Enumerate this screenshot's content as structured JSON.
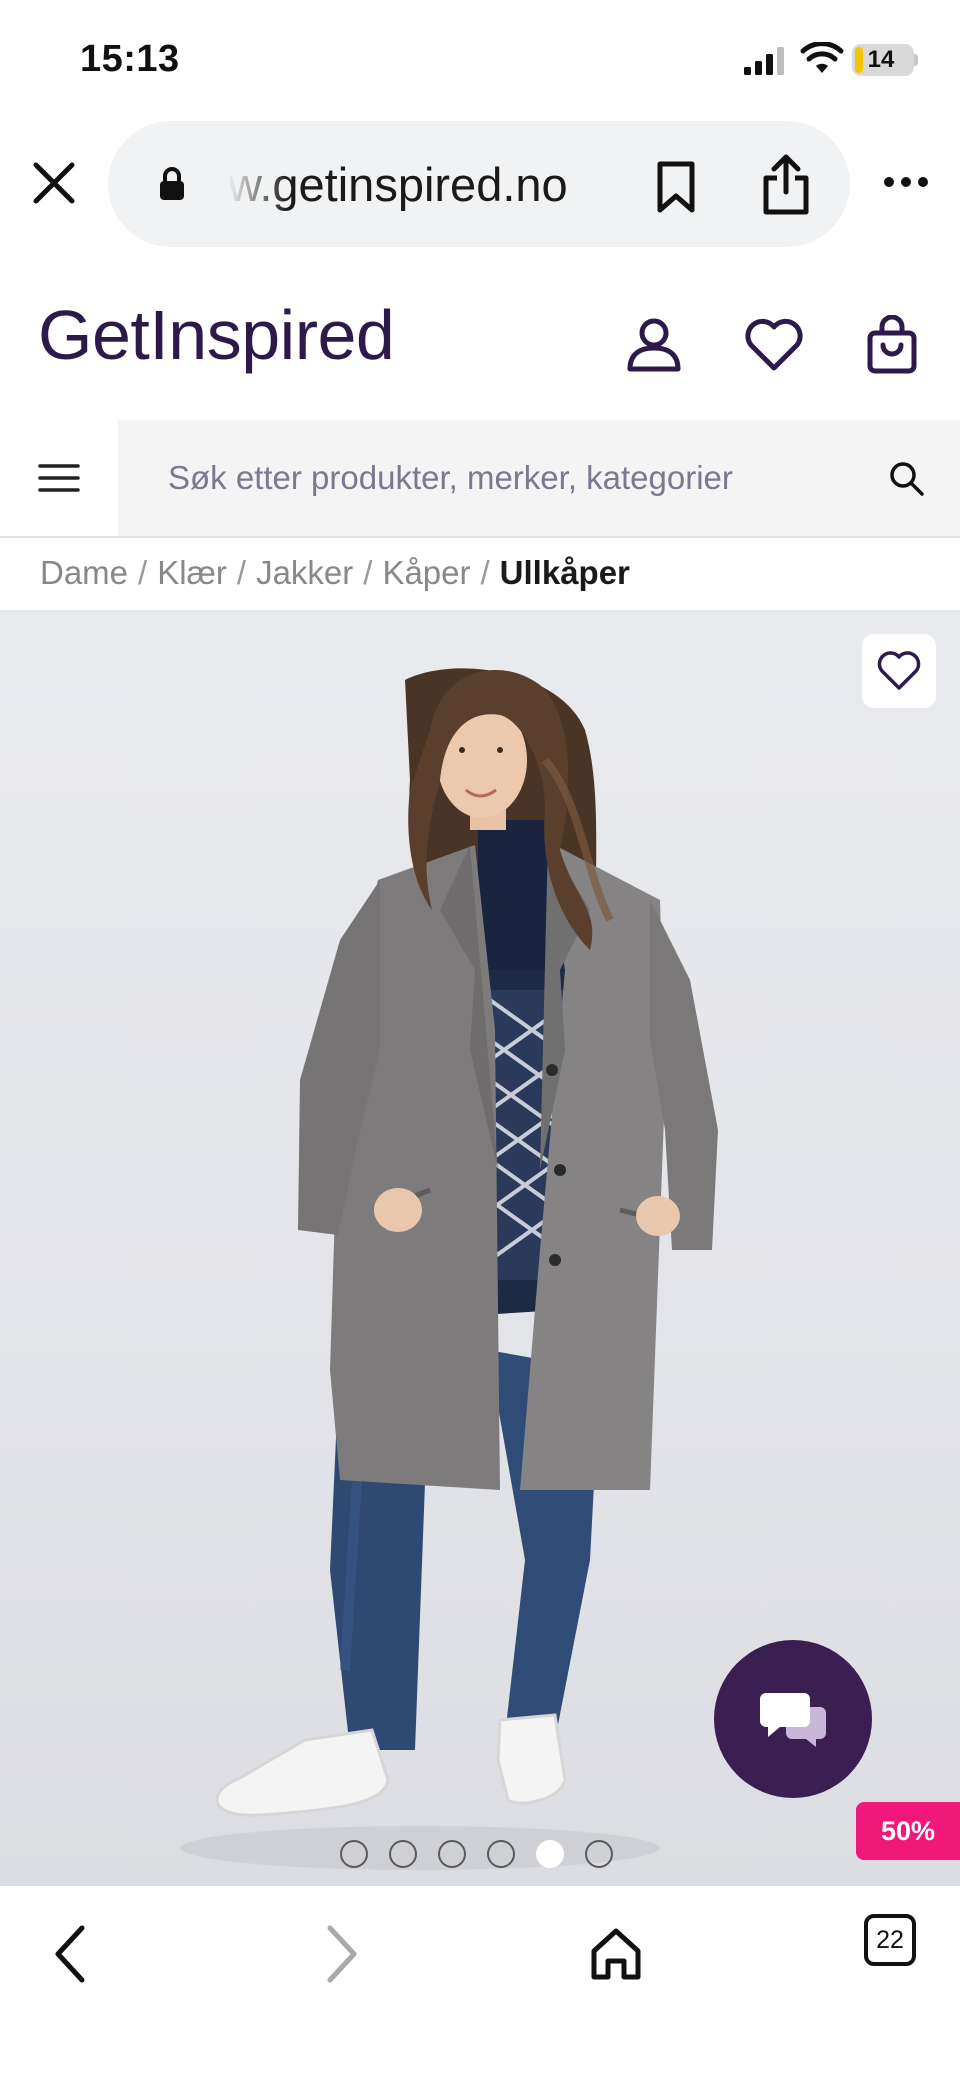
{
  "status_bar": {
    "time": "15:13",
    "battery_level": "14",
    "battery_fraction": 0.14
  },
  "browser": {
    "url": "w.getinspired.no",
    "icons": [
      "close-icon",
      "lock-icon",
      "bookmark-icon",
      "share-icon",
      "more-icon"
    ]
  },
  "site": {
    "logo": "GetInspired",
    "brand_color": "#2d1a4a",
    "header_icons": [
      "account-icon",
      "heart-icon",
      "shopping-bag-icon"
    ]
  },
  "search": {
    "placeholder": "Søk etter produkter, merker, kategorier"
  },
  "breadcrumb": {
    "items": [
      "Dame",
      "Klær",
      "Jakker",
      "Kåper"
    ],
    "separator": "/",
    "current": "Ullkåper"
  },
  "product": {
    "image_count": 6,
    "active_image_index": 4,
    "discount_badge": "50%",
    "discount_color": "#f0187a",
    "chat_button_color": "#3b1e52"
  },
  "bottom_nav": {
    "tabs_count": "22",
    "icons": [
      "back-arrow-icon",
      "forward-arrow-icon",
      "home-icon",
      "tabs-icon"
    ]
  }
}
